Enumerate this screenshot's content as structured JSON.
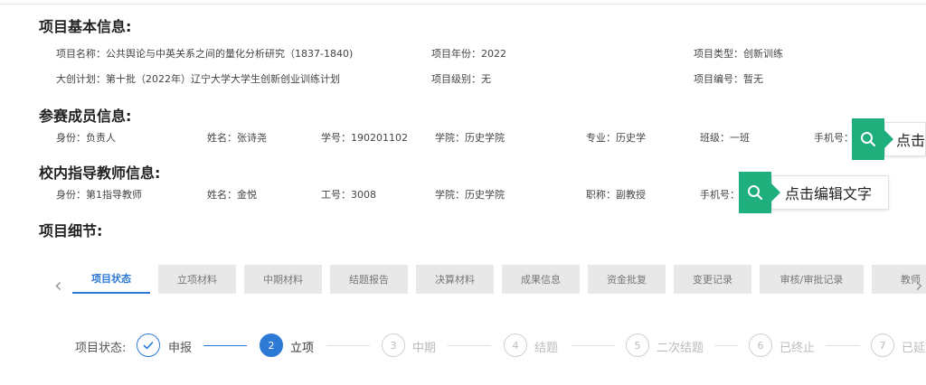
{
  "sections": {
    "basic": "项目基本信息:",
    "members": "参赛成员信息:",
    "advisors": "校内指导教师信息:",
    "details": "项目细节:"
  },
  "basic": {
    "name_label": "项目名称",
    "name_value": "公共舆论与中英关系之间的量化分析研究（1837-1840)",
    "year_label": "项目年份",
    "year_value": "2022",
    "type_label": "项目类型",
    "type_value": "创新训练",
    "plan_label": "大创计划",
    "plan_value": "第十批（2022年）辽宁大学大学生创新创业训练计划",
    "level_label": "项目级别",
    "level_value": "无",
    "code_label": "项目编号",
    "code_value": "暂无"
  },
  "member": {
    "role_label": "身份",
    "role_value": "负责人",
    "name_label": "姓名",
    "name_value": "张诗尧",
    "id_label": "学号",
    "id_value": "190201102",
    "college_label": "学院",
    "college_value": "历史学院",
    "major_label": "专业",
    "major_value": "历史学",
    "class_label": "班级",
    "class_value": "一班",
    "phone_label": "手机号",
    "phone_value": ""
  },
  "advisor": {
    "role_label": "身份",
    "role_value": "第1指导教师",
    "name_label": "姓名",
    "name_value": "金悦",
    "id_label": "工号",
    "id_value": "3008",
    "college_label": "学院",
    "college_value": "历史学院",
    "title_label": "职称",
    "title_value": "副教授",
    "phone_label": "手机号",
    "phone_value": ""
  },
  "callouts": {
    "member_text": "点击",
    "advisor_text": "点击编辑文字"
  },
  "icons": {
    "callout": "search-icon",
    "prev": "chevron-left-icon",
    "next": "chevron-right-icon",
    "check": "check-icon"
  },
  "colors": {
    "accent": "#2d7ad6",
    "callout": "#1faf7d"
  },
  "tabs": [
    "项目状态",
    "立项材料",
    "中期材料",
    "结题报告",
    "决算材料",
    "成果信息",
    "资金批复",
    "变更记录",
    "审核/审批记录",
    "教师"
  ],
  "status": {
    "label": "项目状态:",
    "steps": [
      {
        "num": "",
        "label": "申报"
      },
      {
        "num": "2",
        "label": "立项"
      },
      {
        "num": "3",
        "label": "中期"
      },
      {
        "num": "4",
        "label": "结题"
      },
      {
        "num": "5",
        "label": "二次结题"
      },
      {
        "num": "6",
        "label": "已终止"
      },
      {
        "num": "7",
        "label": "已延"
      }
    ]
  }
}
